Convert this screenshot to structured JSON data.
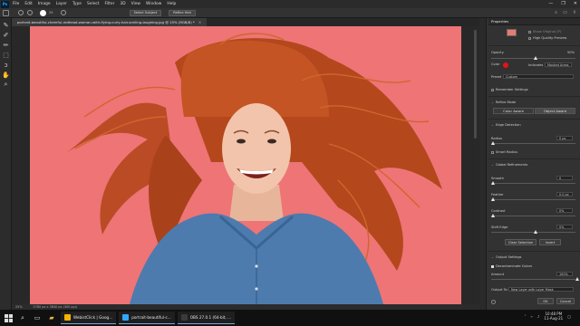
{
  "app": {
    "logo": "Ps",
    "menus": [
      "File",
      "Edit",
      "Image",
      "Layer",
      "Type",
      "Select",
      "Filter",
      "3D",
      "View",
      "Window",
      "Help"
    ],
    "window_controls": [
      "—",
      "❐",
      "✕"
    ]
  },
  "options": {
    "brush_size": "25",
    "select_subject_label": "Select Subject",
    "refine_hair_label": "Refine Hair"
  },
  "document": {
    "tab_title": "portrait-beautiful-cheerful-redhead-woman-with-flying-curly-hair-smiling-laughing.jpg @ 25% (RGB/8) *",
    "close_glyph": "×"
  },
  "status": {
    "zoom": "25%",
    "doc_info": "5760 px x 3840 px (300 ppi)"
  },
  "properties": {
    "title": "Properties",
    "show_original_label": "Show Original (P)",
    "high_quality_label": "High Quality Preview",
    "opacity_label": "Opacity",
    "opacity_value": "50%",
    "color_label": "Color",
    "color_value": "#e8101a",
    "indicates_label": "Indicates",
    "indicates_value": "Masked Areas",
    "preset_label": "Preset",
    "preset_value": "Custom",
    "remember_label": "Remember Settings",
    "refine_mode_title": "Refine Mode",
    "color_aware_label": "Color Aware",
    "object_aware_label": "Object Aware",
    "edge_detection_title": "Edge Detection",
    "radius_label": "Radius",
    "radius_value": "0 px",
    "radius_fraction": 0.0,
    "smart_radius_label": "Smart Radius",
    "global_refinements_title": "Global Refinements",
    "smooth_label": "Smooth",
    "smooth_value": "0",
    "smooth_fraction": 0.0,
    "feather_label": "Feather",
    "feather_value": "0.0 px",
    "feather_fraction": 0.0,
    "contrast_label": "Contrast",
    "contrast_value": "0%",
    "contrast_fraction": 0.0,
    "shift_edge_label": "Shift Edge",
    "shift_edge_value": "0%",
    "shift_edge_fraction": 0.5,
    "clear_selection_label": "Clear Selection",
    "invert_label": "Invert",
    "output_settings_title": "Output Settings",
    "decontaminate_label": "Decontaminate Colors",
    "amount_label": "Amount",
    "amount_value": "100%",
    "amount_fraction": 1.0,
    "output_to_label": "Output To:",
    "output_to_value": "New Layer with Layer Mask",
    "ok_label": "OK",
    "cancel_label": "Cancel"
  },
  "taskbar": {
    "search_icon": "search-icon",
    "tasks": [
      {
        "label": "WebistClick | Goog...",
        "color": "#f4b400"
      },
      {
        "label": "portrait-beautiful-c...",
        "color": "#31a8ff"
      },
      {
        "label": "OBS 27.0.1 (64-bit, ...",
        "color": "#3a3a3a"
      }
    ],
    "time": "10:48 PM",
    "date": "11-Aug-21"
  }
}
